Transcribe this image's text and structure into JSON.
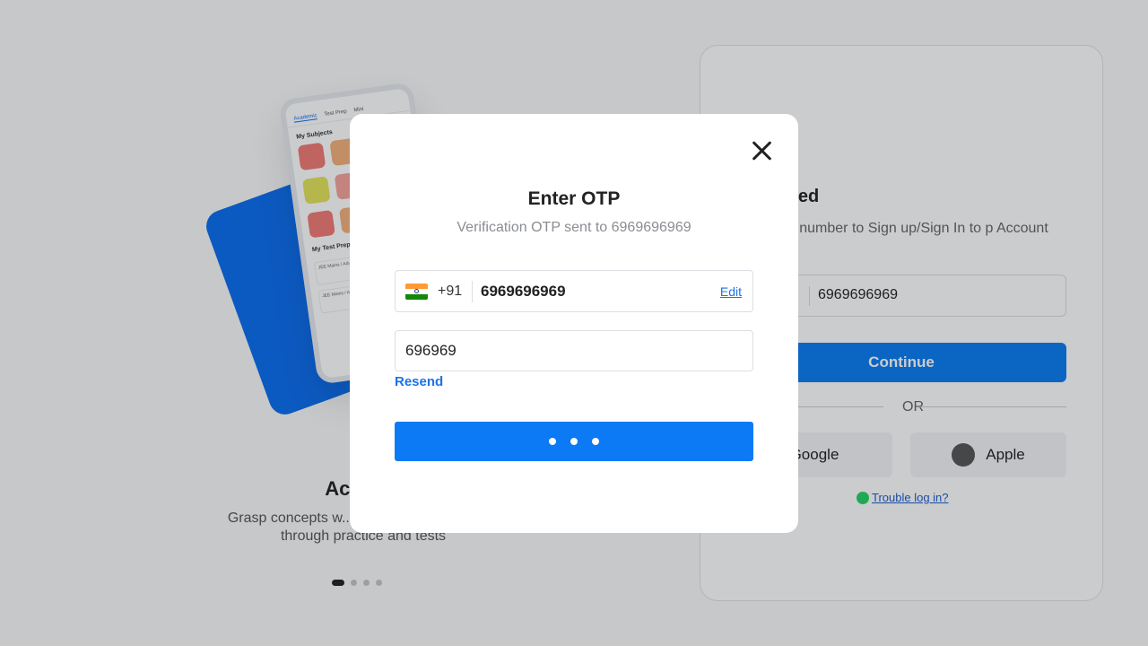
{
  "background": {
    "promo": {
      "phone_tabs": [
        "Academic",
        "Test Prep",
        "Mini"
      ],
      "phone_section_subjects": "My Subjects",
      "phone_section_testprep": "My Test Prep",
      "phone_rows": [
        "JEE Mains / Advanced",
        "JEE Mains / Advanced"
      ],
      "slide_title": "Academ",
      "slide_text": "Grasp concepts w... and boost your scores through practice and tests",
      "slide_count": 4,
      "active_slide": 1
    },
    "login_card": {
      "logo": "ep",
      "heading": "et Started",
      "subtitle": "ur Mobile number to Sign up/Sign In to p Account",
      "phone_value": "6969696969",
      "continue_label": "Continue",
      "or_label": "OR",
      "google_label": "Google",
      "apple_label": "Apple",
      "trouble_label": "Trouble log in?"
    }
  },
  "modal": {
    "title": "Enter OTP",
    "subtitle": "Verification OTP sent to 6969696969",
    "country_code": "+91",
    "phone_number": "6969696969",
    "edit_label": "Edit",
    "otp_value": "696969",
    "resend_label": "Resend",
    "submit_state": "loading"
  },
  "colors": {
    "accent": "#0b7af4",
    "link": "#1a73e8",
    "overlay": "rgba(20,22,26,0.22)"
  }
}
